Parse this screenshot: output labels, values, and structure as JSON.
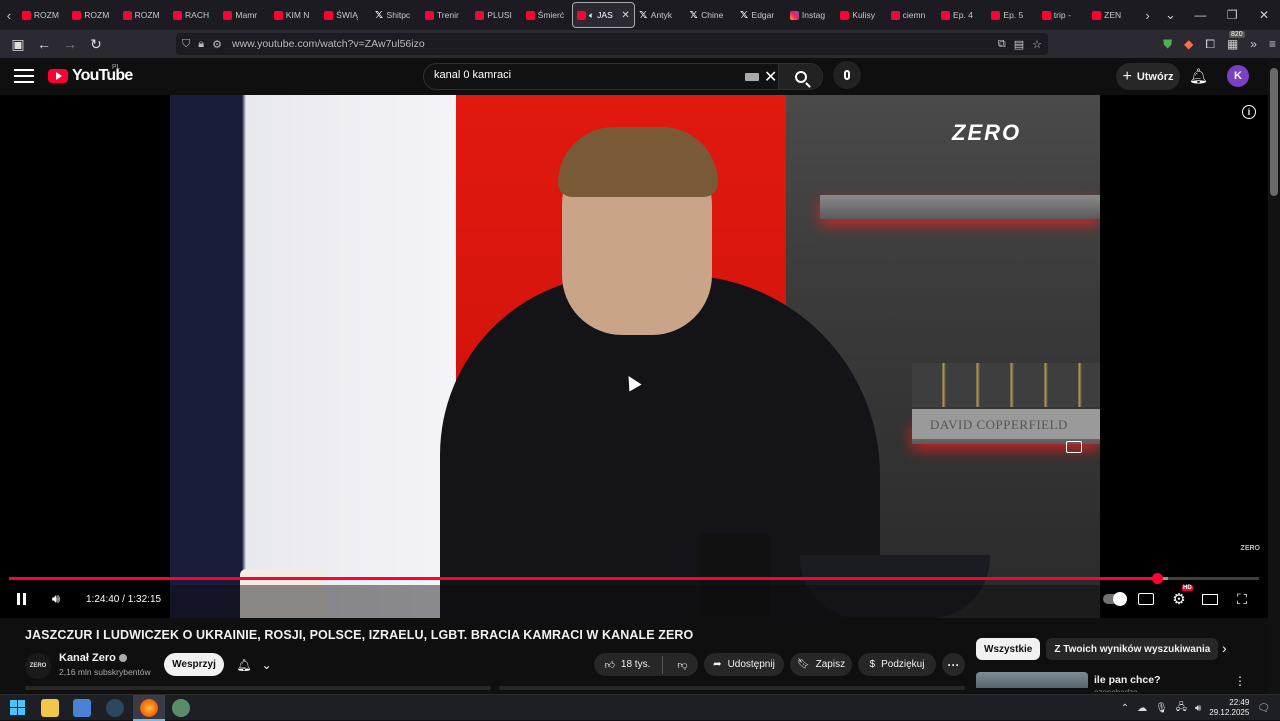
{
  "browser": {
    "tabs": [
      {
        "label": "ROZM",
        "icon": "youtube-icon"
      },
      {
        "label": "ROZM",
        "icon": "youtube-icon"
      },
      {
        "label": "ROZM",
        "icon": "youtube-icon"
      },
      {
        "label": "RACH",
        "icon": "youtube-icon"
      },
      {
        "label": "Mamr",
        "icon": "youtube-icon"
      },
      {
        "label": "KIM N",
        "icon": "youtube-icon"
      },
      {
        "label": "ŚWIĄ",
        "icon": "youtube-icon"
      },
      {
        "label": "Shitpc",
        "icon": "x-icon"
      },
      {
        "label": "Trenir",
        "icon": "youtube-icon"
      },
      {
        "label": "PLUSI",
        "icon": "youtube-icon"
      },
      {
        "label": "Śmierć",
        "icon": "youtube-icon"
      },
      {
        "label": "JAS",
        "icon": "youtube-icon",
        "active": true
      },
      {
        "label": "Antyk",
        "icon": "x-icon"
      },
      {
        "label": "Chine",
        "icon": "x-icon"
      },
      {
        "label": "Edgar",
        "icon": "x-icon"
      },
      {
        "label": "Instag",
        "icon": "instagram-icon"
      },
      {
        "label": "Kulisy",
        "icon": "youtube-icon"
      },
      {
        "label": "ciemn",
        "icon": "youtube-icon"
      },
      {
        "label": "Ep. 4",
        "icon": "youtube-icon"
      },
      {
        "label": "Ep. 5",
        "icon": "youtube-icon"
      },
      {
        "label": "trip -",
        "icon": "youtube-icon"
      },
      {
        "label": "ZEN",
        "icon": "youtube-icon"
      }
    ],
    "url": "www.youtube.com/watch?v=ZAw7ul56izo",
    "extension_badge": "820"
  },
  "youtube": {
    "logo_text": "YouTube",
    "logo_region": "PL",
    "search_value": "kanal 0 kamraci",
    "create_label": "Utwórz",
    "avatar_letter": "K"
  },
  "player": {
    "watermark": "ZERO",
    "corner_watermark": "ZERO",
    "book_text": "DAVID COPPERFIELD",
    "time_display": "1:24:40 / 1:32:15",
    "progress_fraction": 0.918,
    "buffer_fraction": 0.927,
    "settings_badge": "HD",
    "autoplay_on": true
  },
  "video": {
    "title": "JASZCZUR I LUDWICZEK O UKRAINIE, ROSJI, POLSCE, IZRAELU, LGBT. BRACIA KAMRACI W KANALE ZERO",
    "channel_name": "Kanał Zero",
    "channel_avatar_text": "ZERO",
    "subscribers": "2,16 mln subskrybentów",
    "support_label": "Wesprzyj",
    "likes": "18 tys.",
    "share_label": "Udostępnij",
    "save_label": "Zapisz",
    "thanks_label": "Podziękuj"
  },
  "sidebar": {
    "chips": [
      {
        "label": "Wszystkie",
        "active": true
      },
      {
        "label": "Z Twoich wyników wyszukiwania",
        "active": false
      }
    ],
    "recommendation": {
      "title": "ile pan chce?",
      "channel": "ozonebadzo"
    }
  },
  "taskbar": {
    "time": "22:49",
    "date": "29.12.2025"
  },
  "colors": {
    "accent": "#ff0033",
    "background": "#0f0f0f",
    "chip_bg": "#272727"
  }
}
